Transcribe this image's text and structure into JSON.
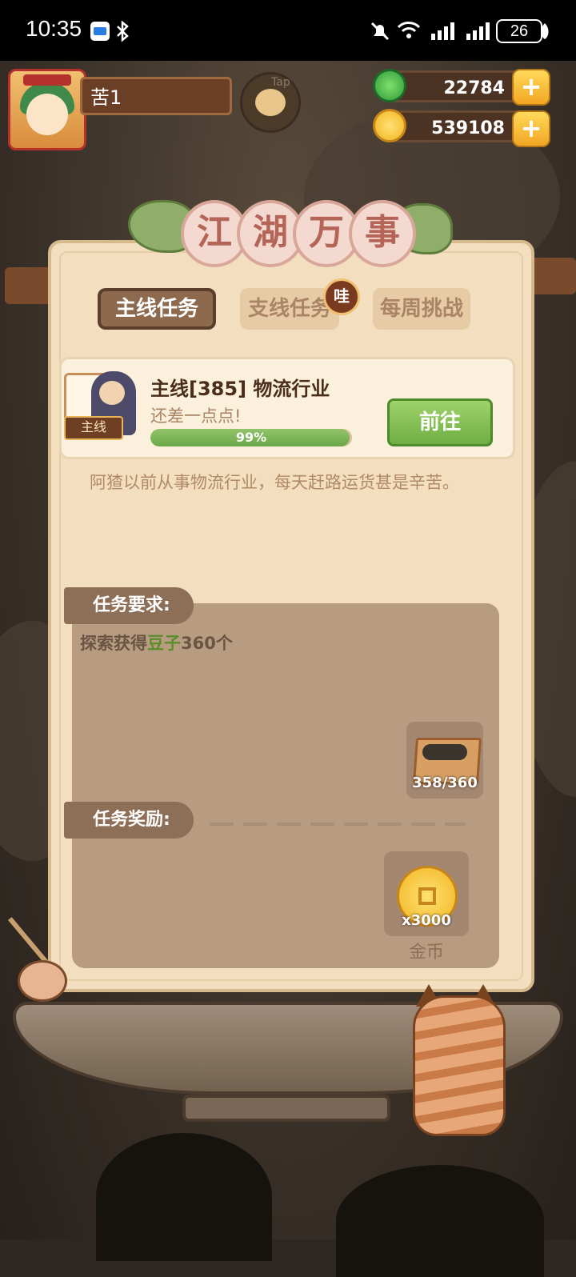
{
  "status_bar": {
    "time": "10:35",
    "battery": "26"
  },
  "hud": {
    "player_name": "苦1",
    "tap_label": "Tap",
    "jade": "22784",
    "coins": "539108"
  },
  "panel": {
    "title_chars": [
      "江",
      "湖",
      "万",
      "事"
    ],
    "tabs": [
      {
        "label": "主线任务",
        "active": true
      },
      {
        "label": "支线任务",
        "active": false,
        "badge": "哇"
      },
      {
        "label": "每周挑战",
        "active": false
      }
    ]
  },
  "task": {
    "tag": "主线",
    "title": "主线[385] 物流行业",
    "subtitle": "还差一点点!",
    "progress_percent": 99,
    "progress_label": "99%",
    "go_label": "前往",
    "description": "阿猹以前从事物流行业，每天赶路运货甚是辛苦。"
  },
  "requirement": {
    "section_label": "任务要求:",
    "text_prefix": "探索获得",
    "text_highlight": "豆子",
    "text_suffix": "360个",
    "item_count": "358/360"
  },
  "reward": {
    "section_label": "任务奖励:",
    "amount": "x3000",
    "name": "金币"
  },
  "colors": {
    "accent_green": "#6fae44",
    "panel_bg": "#f3dfc0",
    "title_pink": "#b56458"
  }
}
